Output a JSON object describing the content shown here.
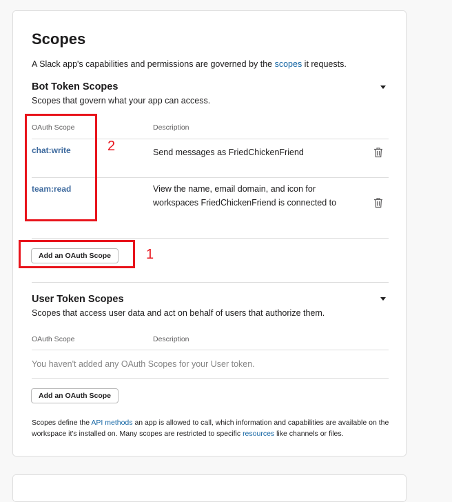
{
  "scopes": {
    "title": "Scopes",
    "intro_before": "A Slack app's capabilities and permissions are governed by the ",
    "intro_link": "scopes",
    "intro_after": " it requests."
  },
  "bot": {
    "title": "Bot Token Scopes",
    "subtitle": "Scopes that govern what your app can access.",
    "col_scope": "OAuth Scope",
    "col_desc": "Description",
    "rows": [
      {
        "scope": "chat:write",
        "description": "Send messages as FriedChickenFriend"
      },
      {
        "scope": "team:read",
        "description": "View the name, email domain, and icon for workspaces FriedChickenFriend is connected to"
      }
    ],
    "add_button": "Add an OAuth Scope"
  },
  "user": {
    "title": "User Token Scopes",
    "subtitle": "Scopes that access user data and act on behalf of users that authorize them.",
    "col_scope": "OAuth Scope",
    "col_desc": "Description",
    "empty": "You haven't added any OAuth Scopes for your User token.",
    "add_button": "Add an OAuth Scope"
  },
  "footer": {
    "part1": "Scopes define the ",
    "link1": "API methods",
    "part2": " an app is allowed to call, which information and capabilities are available on the workspace it's installed on. Many scopes are restricted to specific ",
    "link2": "resources",
    "part3": " like channels or files."
  },
  "annotations": {
    "label_1": "1",
    "label_2": "2",
    "color": "#e8141c"
  },
  "icons": {
    "collapse": "caret-down-icon",
    "delete": "trash-icon"
  }
}
